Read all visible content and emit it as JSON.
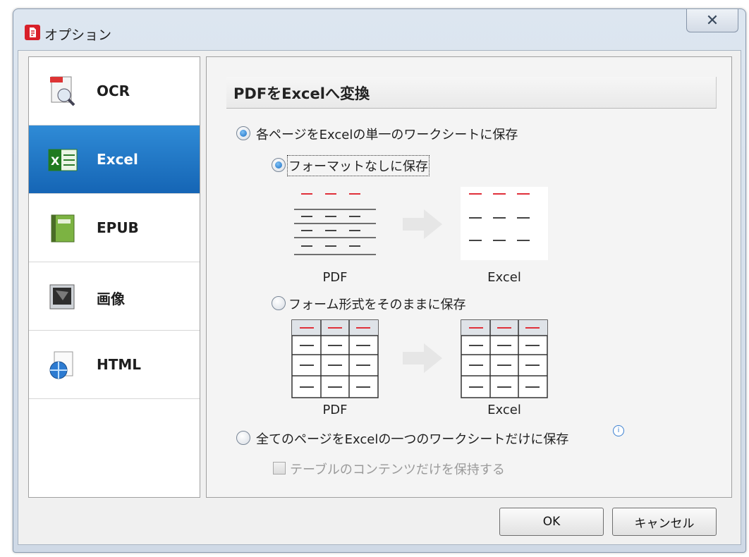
{
  "window": {
    "title": "オプション"
  },
  "sidebar": {
    "items": [
      {
        "label": "OCR",
        "icon": "ocr-document-icon"
      },
      {
        "label": "Excel",
        "icon": "excel-icon",
        "selected": true
      },
      {
        "label": "EPUB",
        "icon": "epub-book-icon"
      },
      {
        "label": "画像",
        "icon": "image-icon"
      },
      {
        "label": "HTML",
        "icon": "html-globe-icon"
      }
    ]
  },
  "panel": {
    "heading": "PDFをExcelへ変換",
    "option_each_page": "各ページをExcelの単一のワークシートに保存",
    "sub_no_format": "フォーマットなしに保存",
    "sub_keep_form": "フォーム形式をそのままに保存",
    "caption_pdf_1": "PDF",
    "caption_excel_1": "Excel",
    "caption_pdf_2": "PDF",
    "caption_excel_2": "Excel",
    "option_all_pages": "全てのページをExcelの一つのワークシートだけに保存",
    "checkbox_table_only": "テーブルのコンテンツだけを保持する"
  },
  "state": {
    "option_each_page_selected": true,
    "sub_no_format_selected": true,
    "sub_keep_form_selected": false,
    "option_all_pages_selected": false,
    "checkbox_table_only_checked": false,
    "checkbox_table_only_enabled": false
  },
  "buttons": {
    "ok": "OK",
    "cancel": "キャンセル"
  },
  "colors": {
    "selection": "#1f77c9",
    "accent_red": "#e0303a",
    "app_icon": "#d8202a"
  }
}
